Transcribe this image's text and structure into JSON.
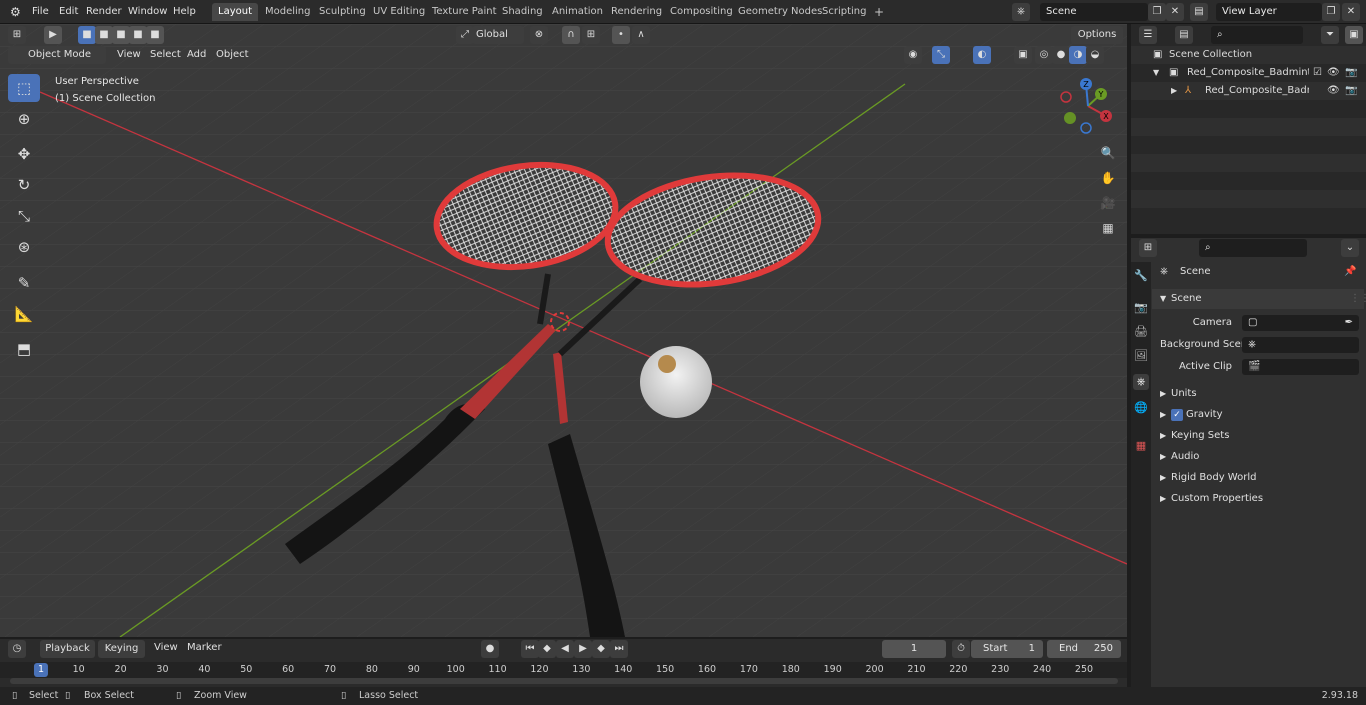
{
  "menu": [
    "File",
    "Edit",
    "Render",
    "Window",
    "Help"
  ],
  "workspaces": [
    "Layout",
    "Modeling",
    "Sculpting",
    "UV Editing",
    "Texture Paint",
    "Shading",
    "Animation",
    "Rendering",
    "Compositing",
    "Geometry Nodes",
    "Scripting"
  ],
  "active_workspace": "Layout",
  "scene_name": "Scene",
  "view_layer": "View Layer",
  "viewport_header": {
    "mode": "Object Mode",
    "menus": [
      "View",
      "Select",
      "Add",
      "Object"
    ],
    "transform_orientation": "Global",
    "options": "Options"
  },
  "viewport_overlay": {
    "perspective": "User Perspective",
    "collection": "(1) Scene Collection"
  },
  "gizmo_axes": {
    "x": "X",
    "y": "Y",
    "z": "Z"
  },
  "outliner": {
    "root": "Scene Collection",
    "items": [
      {
        "label": "Red_Composite_Badminton_I"
      },
      {
        "label": "Red_Composite_Badmin"
      }
    ]
  },
  "properties": {
    "context": "Scene",
    "panel": "Scene",
    "fields": [
      {
        "label": "Camera",
        "value": ""
      },
      {
        "label": "Background Scene",
        "value": ""
      },
      {
        "label": "Active Clip",
        "value": ""
      }
    ],
    "subpanels": [
      "Units",
      "Gravity",
      "Keying Sets",
      "Audio",
      "Rigid Body World",
      "Custom Properties"
    ],
    "gravity_enabled": true
  },
  "timeline": {
    "menus": [
      "Playback",
      "Keying",
      "View",
      "Marker"
    ],
    "current_frame": "1",
    "start_label": "Start",
    "start": "1",
    "end_label": "End",
    "end": "250",
    "ruler": [
      "1",
      "10",
      "20",
      "30",
      "40",
      "50",
      "60",
      "70",
      "80",
      "90",
      "100",
      "110",
      "120",
      "130",
      "140",
      "150",
      "160",
      "170",
      "180",
      "190",
      "200",
      "210",
      "220",
      "230",
      "240",
      "250"
    ]
  },
  "statusbar": {
    "items": [
      "Select",
      "Box Select",
      "Zoom View",
      "Lasso Select"
    ],
    "version": "2.93.18"
  },
  "colors": {
    "accent": "#4a72b8",
    "x_axis": "#c4343f",
    "y_axis": "#6a9b24",
    "racket_red": "#e03a3a"
  }
}
